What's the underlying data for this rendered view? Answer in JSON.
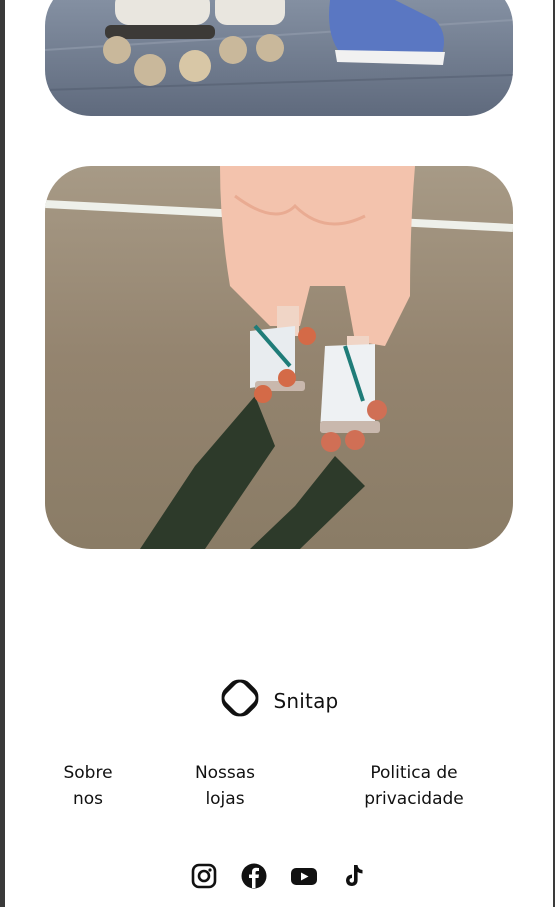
{
  "brand": {
    "name": "Snitap"
  },
  "footer": {
    "links": [
      {
        "label_line1": "Sobre",
        "label_line2": "nos"
      },
      {
        "label_line1": "Nossas",
        "label_line2": "lojas"
      },
      {
        "label_line1": "Politica de",
        "label_line2": "privacidade"
      }
    ]
  },
  "social": {
    "icons": [
      "instagram-icon",
      "facebook-icon",
      "youtube-icon",
      "tiktok-icon"
    ]
  },
  "colors": {
    "text": "#111111",
    "page_background": "#ffffff",
    "frame": "#3a3a3a"
  }
}
